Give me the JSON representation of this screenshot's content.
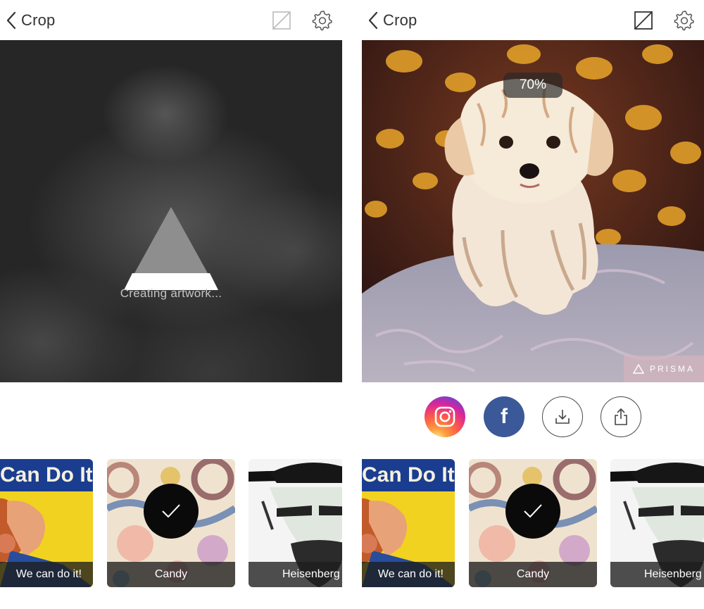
{
  "navbar": {
    "back_label": "Crop"
  },
  "left_screen": {
    "status_text": "Creating artwork...",
    "spinner_icon": "prisma-triangle-icon"
  },
  "right_screen": {
    "intensity_label": "70%",
    "watermark": "PRISMA"
  },
  "share": {
    "buttons": [
      "instagram",
      "facebook",
      "save-download",
      "share"
    ]
  },
  "filters": [
    {
      "label": "We can do it!",
      "thumb_text": "Can Do It!"
    },
    {
      "label": "Candy",
      "selected": true
    },
    {
      "label": "Heisenberg"
    }
  ],
  "colors": {
    "facebook": "#3b5998",
    "loading_bg": "#262626",
    "check_circle": "#0a0a0a"
  }
}
